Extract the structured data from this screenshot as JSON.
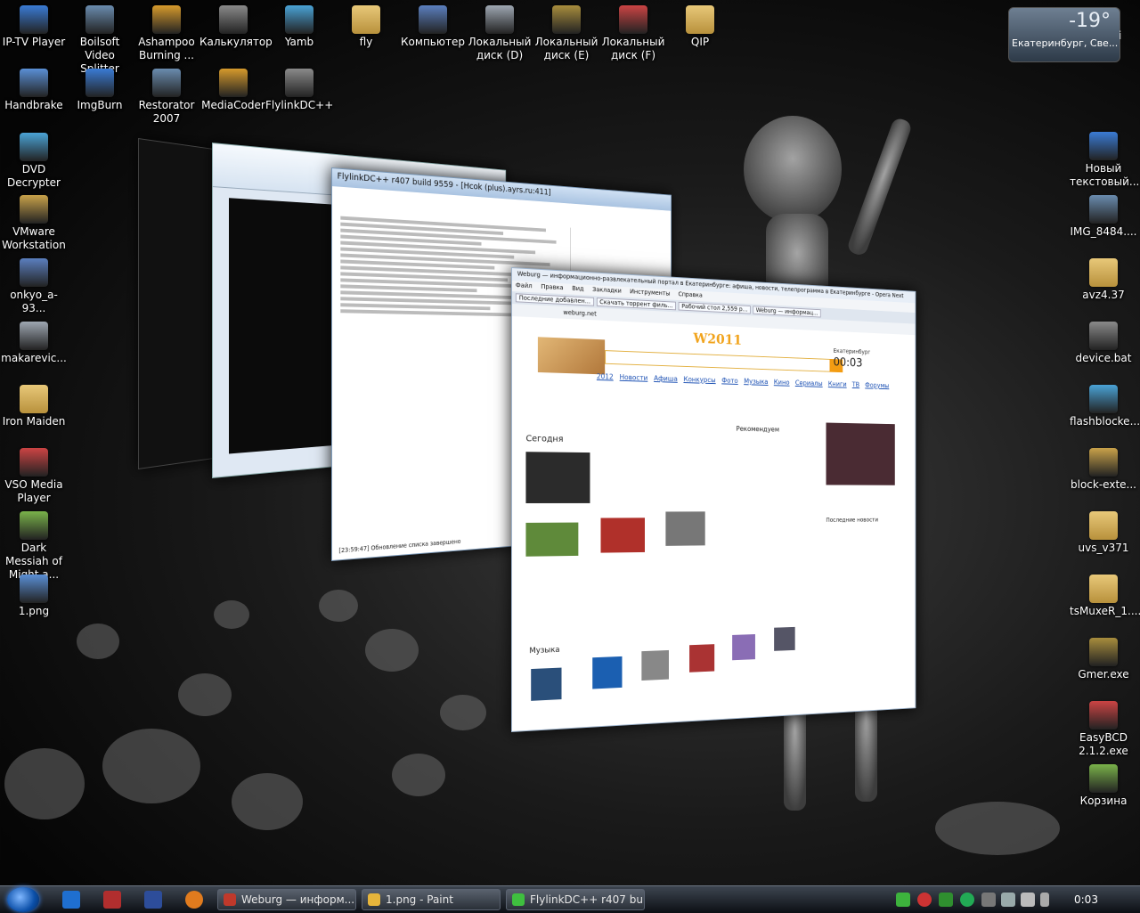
{
  "desktop": {
    "left_icons": [
      {
        "label": "IP-TV Player",
        "icon": "tv-icon"
      },
      {
        "label": "Boilsoft Video Splitter",
        "icon": "scissors-icon"
      },
      {
        "label": "Ashampoo Burning ...",
        "icon": "disc-burn-icon"
      },
      {
        "label": "Калькулятор",
        "icon": "calculator-icon"
      },
      {
        "label": "Yamb",
        "icon": "yamb-icon"
      },
      {
        "label": "fly",
        "icon": "folder-icon"
      },
      {
        "label": "Компьютер",
        "icon": "computer-icon"
      },
      {
        "label": "Локальный диск (D)",
        "icon": "drive-icon"
      },
      {
        "label": "Локальный диск (E)",
        "icon": "drive-icon"
      },
      {
        "label": "Локальный диск (F)",
        "icon": "drive-icon"
      },
      {
        "label": "QIP",
        "icon": "folder-icon"
      },
      {
        "label": "Handbrake",
        "icon": "pineapple-icon"
      },
      {
        "label": "ImgBurn",
        "icon": "disc-icon"
      },
      {
        "label": "Restorator 2007",
        "icon": "restorator-icon"
      },
      {
        "label": "MediaCoder",
        "icon": "mediacoder-icon"
      },
      {
        "label": "FlylinkDC++",
        "icon": "flylink-icon"
      },
      {
        "label": "DVD Decrypter",
        "icon": "dvd-icon"
      },
      {
        "label": "VMware Workstation",
        "icon": "vmware-icon"
      },
      {
        "label": "onkyo_a-93...",
        "icon": "document-icon"
      },
      {
        "label": "makarevic...",
        "icon": "word-document-icon"
      },
      {
        "label": "Iron Maiden",
        "icon": "folder-icon"
      },
      {
        "label": "VSO Media Player",
        "icon": "media-player-icon"
      },
      {
        "label": "Dark Messiah of Might a...",
        "icon": "game-icon"
      },
      {
        "label": "1.png",
        "icon": "image-file-icon"
      }
    ],
    "right_icons": [
      {
        "label": "Новый текстовый...",
        "icon": "text-file-icon"
      },
      {
        "label": "IMG_8484....",
        "icon": "image-file-icon"
      },
      {
        "label": "avz4.37",
        "icon": "folder-icon"
      },
      {
        "label": "device.bat",
        "icon": "batch-file-icon"
      },
      {
        "label": "flashblocke...",
        "icon": "archive-icon"
      },
      {
        "label": "block-exte...",
        "icon": "archive-icon"
      },
      {
        "label": "uvs_v371",
        "icon": "folder-icon"
      },
      {
        "label": "tsMuxeR_1....",
        "icon": "folder-icon"
      },
      {
        "label": "Gmer.exe",
        "icon": "gmer-icon"
      },
      {
        "label": "EasyBCD 2.1.2.exe",
        "icon": "easybcd-icon"
      },
      {
        "label": "Корзина",
        "icon": "recycle-bin-icon"
      }
    ]
  },
  "weather": {
    "temp": "-19°",
    "city": "Екатеринбург, Све...",
    "extra": "i"
  },
  "windows": {
    "flylink_title": "FlylinkDC++ r407 build 9559 - [Hcok (plus).ayrs.ru:411]",
    "flylink_status": "[23:59:47] Обновление списка завершено",
    "opera_title": "Weburg — информационно-развлекательный портал в Екатеринбурге: афиша, новости, телепрограмма в Екатеринбурге - Opera Next",
    "opera_menu": [
      "Файл",
      "Правка",
      "Вид",
      "Закладки",
      "Инструменты",
      "Справка"
    ],
    "opera_tabs": [
      "Последние добавлен...",
      "Скачать торрент филь...",
      "Рабочий стол 2,559 р...",
      "Weburg — информац..."
    ],
    "opera_address": "weburg.net",
    "site": {
      "logo": "W2011",
      "nav": [
        "2012",
        "Новости",
        "Афиша",
        "Конкурсы",
        "Фото",
        "Музыка",
        "Кино",
        "Сериалы",
        "Книги",
        "ТВ",
        "Форумы"
      ],
      "city": "Екатеринбург",
      "time": "00:03",
      "today": "Сегодня",
      "recommend": "Рекомендуем",
      "music": "Музыка",
      "latest_news": "Последние новости"
    }
  },
  "taskbar": {
    "tasks": [
      {
        "label": "Weburg — информ...",
        "icon": "opera-icon",
        "color": "#c0392b"
      },
      {
        "label": "1.png - Paint",
        "icon": "paint-icon",
        "color": "#e6b53b"
      },
      {
        "label": "FlylinkDC++ r407 bui...",
        "icon": "flylink-icon",
        "color": "#3fbf3f"
      }
    ],
    "clock": "0:03"
  }
}
